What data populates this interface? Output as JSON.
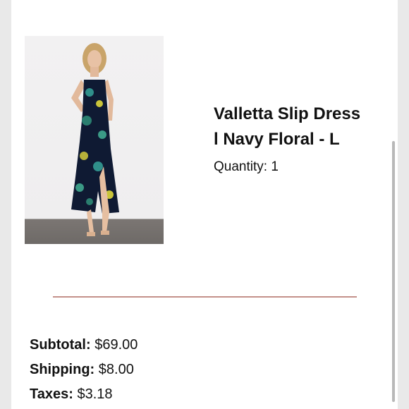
{
  "product": {
    "title_line1": "Valletta Slip Dress",
    "title_line2": "l Navy Floral - L",
    "quantity_label": "Quantity:",
    "quantity_value": "1"
  },
  "summary": {
    "subtotal_label": "Subtotal:",
    "subtotal_value": "$69.00",
    "shipping_label": "Shipping:",
    "shipping_value": "$8.00",
    "taxes_label": "Taxes:",
    "taxes_value": "$3.18"
  },
  "colors": {
    "divider": "#c4918a",
    "dress": "#0f1a33"
  }
}
